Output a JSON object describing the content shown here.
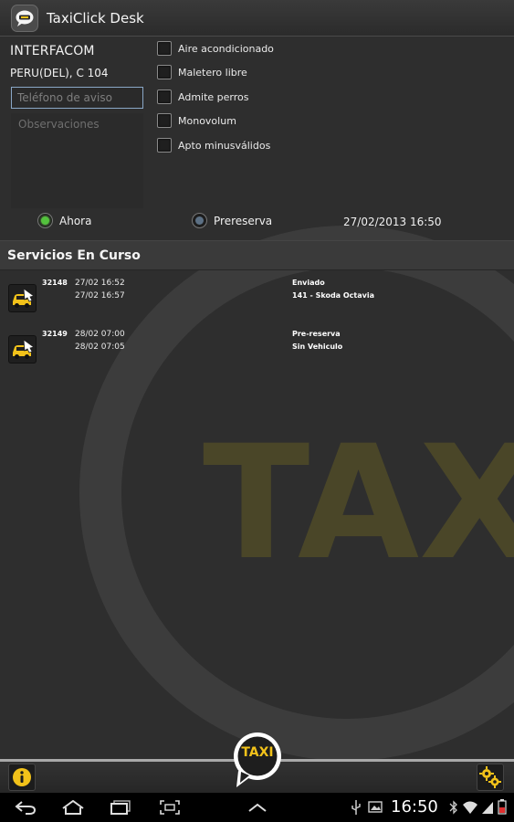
{
  "app": {
    "title": "TaxiClick Desk"
  },
  "client": {
    "name": "INTERFACOM",
    "address": "PERU(DEL), C 104"
  },
  "form": {
    "phone_placeholder": "Teléfono de aviso",
    "phone_value": "",
    "observations_placeholder": "Observaciones",
    "observations_value": ""
  },
  "options": [
    {
      "label": "Aire acondicionado",
      "checked": false
    },
    {
      "label": "Maletero libre",
      "checked": false
    },
    {
      "label": "Admite perros",
      "checked": false
    },
    {
      "label": "Monovolum",
      "checked": false
    },
    {
      "label": "Apto minusválidos",
      "checked": false
    }
  ],
  "timing": {
    "now_label": "Ahora",
    "preorder_label": "Prereserva",
    "selected": "Ahora",
    "datetime": "27/02/2013 16:50"
  },
  "services": {
    "header": "Servicios En Curso",
    "rows": [
      {
        "id": "32148",
        "time1": "27/02 16:52",
        "time2": "27/02 16:57",
        "status": "Enviado",
        "vehicle": "141 - Skoda Octavia"
      },
      {
        "id": "32149",
        "time1": "28/02 07:00",
        "time2": "28/02 07:05",
        "status": "Pre-reserva",
        "vehicle": "Sin Vehiculo"
      }
    ]
  },
  "watermark_text": "TAXI",
  "bottom": {
    "taxi_button_label": "TAXI"
  },
  "system": {
    "clock": "16:50"
  },
  "colors": {
    "background": "#2e2e2e",
    "accent_yellow": "#f2c21a",
    "watermark_yellow": "#4a4628",
    "radio_active": "#53c23d",
    "input_focus_border": "#8aa7c7"
  },
  "icons": {
    "app": "taxi-speech-bubble-icon",
    "service": "taxi-car-icon",
    "info": "info-icon",
    "settings": "gears-icon",
    "nav": [
      "back-icon",
      "home-icon",
      "recent-apps-icon",
      "screenshot-icon",
      "expand-up-icon"
    ],
    "status": [
      "usb-icon",
      "image-icon",
      "bluetooth-icon",
      "wifi-icon",
      "signal-icon",
      "battery-icon"
    ]
  }
}
